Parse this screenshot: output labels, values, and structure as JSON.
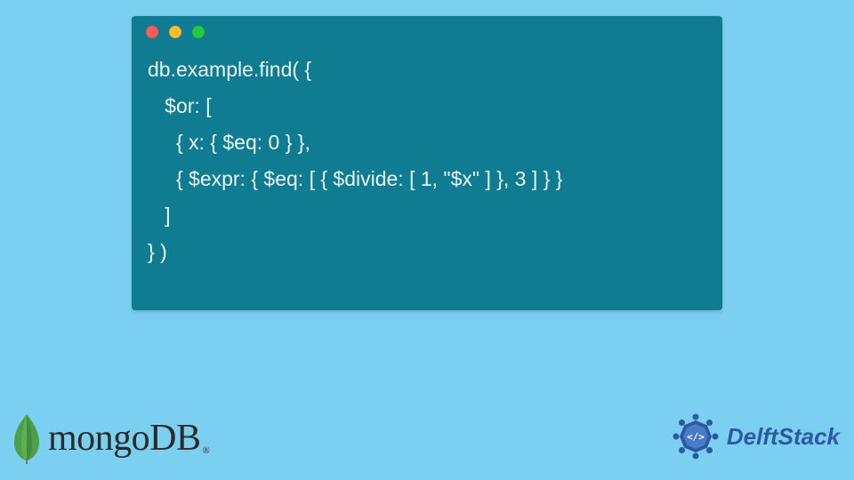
{
  "code": {
    "lines": [
      "db.example.find( {",
      "   $or: [",
      "     { x: { $eq: 0 } },",
      "     { $expr: { $eq: [ { $divide: [ 1, \"$x\" ] }, 3 ] } }",
      "   ]",
      "} )"
    ]
  },
  "logos": {
    "mongo": "mongoDB",
    "mongo_reg": "®",
    "delft": "DelftStack"
  },
  "colors": {
    "background": "#7bcff0",
    "window": "#0f7c91",
    "red": "#ff5f56",
    "yellow": "#ffbd2e",
    "green": "#27c93f"
  }
}
